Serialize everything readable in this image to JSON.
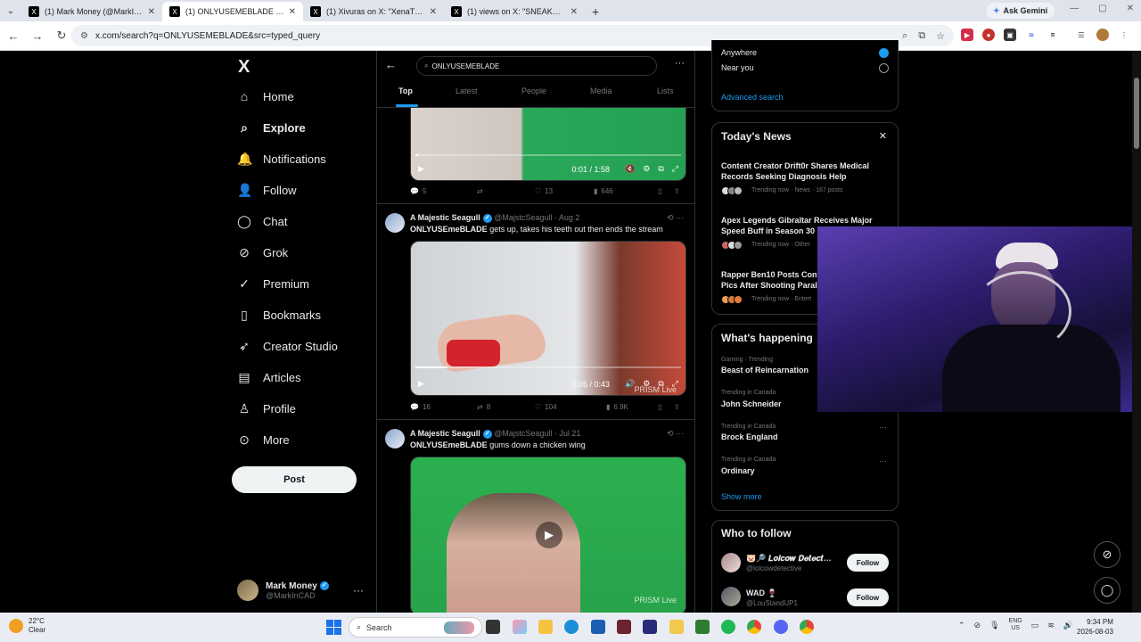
{
  "browser": {
    "tabs": [
      {
        "title": "(1) Mark Money (@MarkInCAD",
        "active": false
      },
      {
        "title": "(1) ONLYUSEMEBLADE - Search",
        "active": true
      },
      {
        "title": "(1) Xivuras on X: \"XenaTheWitc",
        "active": false
      },
      {
        "title": "(1) views on X: \"SNEAKO's ex-g",
        "active": false
      }
    ],
    "ask_gemini": "Ask Gemini",
    "url": "x.com/search?q=ONLYUSEMEBLADE&src=typed_query"
  },
  "leftnav": {
    "logo": "X",
    "items": [
      {
        "label": "Home",
        "icon": "home-icon",
        "glyph": "⌂"
      },
      {
        "label": "Explore",
        "icon": "search-icon",
        "glyph": "⌕"
      },
      {
        "label": "Notifications",
        "icon": "bell-icon",
        "glyph": "🔔"
      },
      {
        "label": "Follow",
        "icon": "person-add-icon",
        "glyph": "👤"
      },
      {
        "label": "Chat",
        "icon": "chat-icon",
        "glyph": "◯"
      },
      {
        "label": "Grok",
        "icon": "grok-icon",
        "glyph": "⊘"
      },
      {
        "label": "Premium",
        "icon": "premium-icon",
        "glyph": "✓"
      },
      {
        "label": "Bookmarks",
        "icon": "bookmark-icon",
        "glyph": "▯"
      },
      {
        "label": "Creator Studio",
        "icon": "rocket-icon",
        "glyph": "➶"
      },
      {
        "label": "Articles",
        "icon": "article-icon",
        "glyph": "▤"
      },
      {
        "label": "Profile",
        "icon": "profile-icon",
        "glyph": "♙"
      },
      {
        "label": "More",
        "icon": "more-circle-icon",
        "glyph": "⊙"
      }
    ],
    "post_button": "Post",
    "account": {
      "name": "Mark Money",
      "handle": "@MarkInCAD",
      "dots": "···"
    }
  },
  "search": {
    "query": "ONLYUSEMEBLADE",
    "tabs": [
      "Top",
      "Latest",
      "People",
      "Media",
      "Lists"
    ]
  },
  "posts": [
    {
      "video": {
        "time": "0:01 / 1:58",
        "progress": 0.01
      },
      "actions": {
        "replies": "5",
        "reposts": "",
        "likes": "13",
        "views": "646"
      }
    },
    {
      "author": "A Majestic Seagull",
      "handle": "@MajstcSeagull",
      "date": "· Aug 2",
      "text_bold": "ONLYUSEmeBLADE",
      "text_rest": " gets up, takes his teeth out then ends the stream",
      "video": {
        "time": "0:05 / 0:43",
        "progress": 0.12,
        "watermark": "PRISM Live"
      },
      "actions": {
        "replies": "16",
        "reposts": "8",
        "likes": "104",
        "views": "6.9K"
      }
    },
    {
      "author": "A Majestic Seagull",
      "handle": "@MajstcSeagull",
      "date": "· Jul 21",
      "text_bold": "ONLYUSEmeBLADE",
      "text_rest": " gums down a chicken wing",
      "video": {
        "watermark": "PRISM Live"
      }
    }
  ],
  "sidebar": {
    "location": {
      "anywhere": "Anywhere",
      "near_you": "Near you",
      "advanced": "Advanced search"
    },
    "news": {
      "title": "Today's News",
      "items": [
        {
          "headline": "Content Creator Drift0r Shares Medical Records Seeking Diagnosis Help",
          "meta": "Trending now · News · 167 posts"
        },
        {
          "headline": "Apex Legends Gibraltar Receives Major Speed Buff in Season 30",
          "meta": "Trending now · Other"
        },
        {
          "headline": "Rapper Ben10 Posts Conf Pics After Shooting Paraly",
          "meta": "Trending now · Entert"
        }
      ]
    },
    "happening": {
      "title": "What's happening",
      "items": [
        {
          "context": "Gaming · Trending",
          "topic": "Beast of Reincarnation"
        },
        {
          "context": "Trending in Canada",
          "topic": "John Schneider"
        },
        {
          "context": "Trending in Canada",
          "topic": "Brock England"
        },
        {
          "context": "Trending in Canada",
          "topic": "Ordinary"
        }
      ],
      "show_more": "Show more"
    },
    "who_to_follow": {
      "title": "Who to follow",
      "accounts": [
        {
          "name": "🐷🔎 𝑳𝒐𝒍𝒄𝒐𝒘 𝑫𝒆𝒕𝒆𝒄𝒕…",
          "handle": "@lolcowdetective",
          "button": "Follow"
        },
        {
          "name": "WAD 🍷",
          "handle": "@LouStandUP1",
          "button": "Follow"
        }
      ]
    }
  },
  "taskbar": {
    "weather_temp": "22°C",
    "weather_desc": "Clear",
    "search_placeholder": "Search",
    "lang": "ENG",
    "region": "US",
    "time": "9:34 PM",
    "date": "2026-08-03"
  },
  "colors": {
    "accent": "#1d9bf0",
    "bg": "#000000",
    "border": "#2f3336",
    "muted": "#71767b"
  }
}
